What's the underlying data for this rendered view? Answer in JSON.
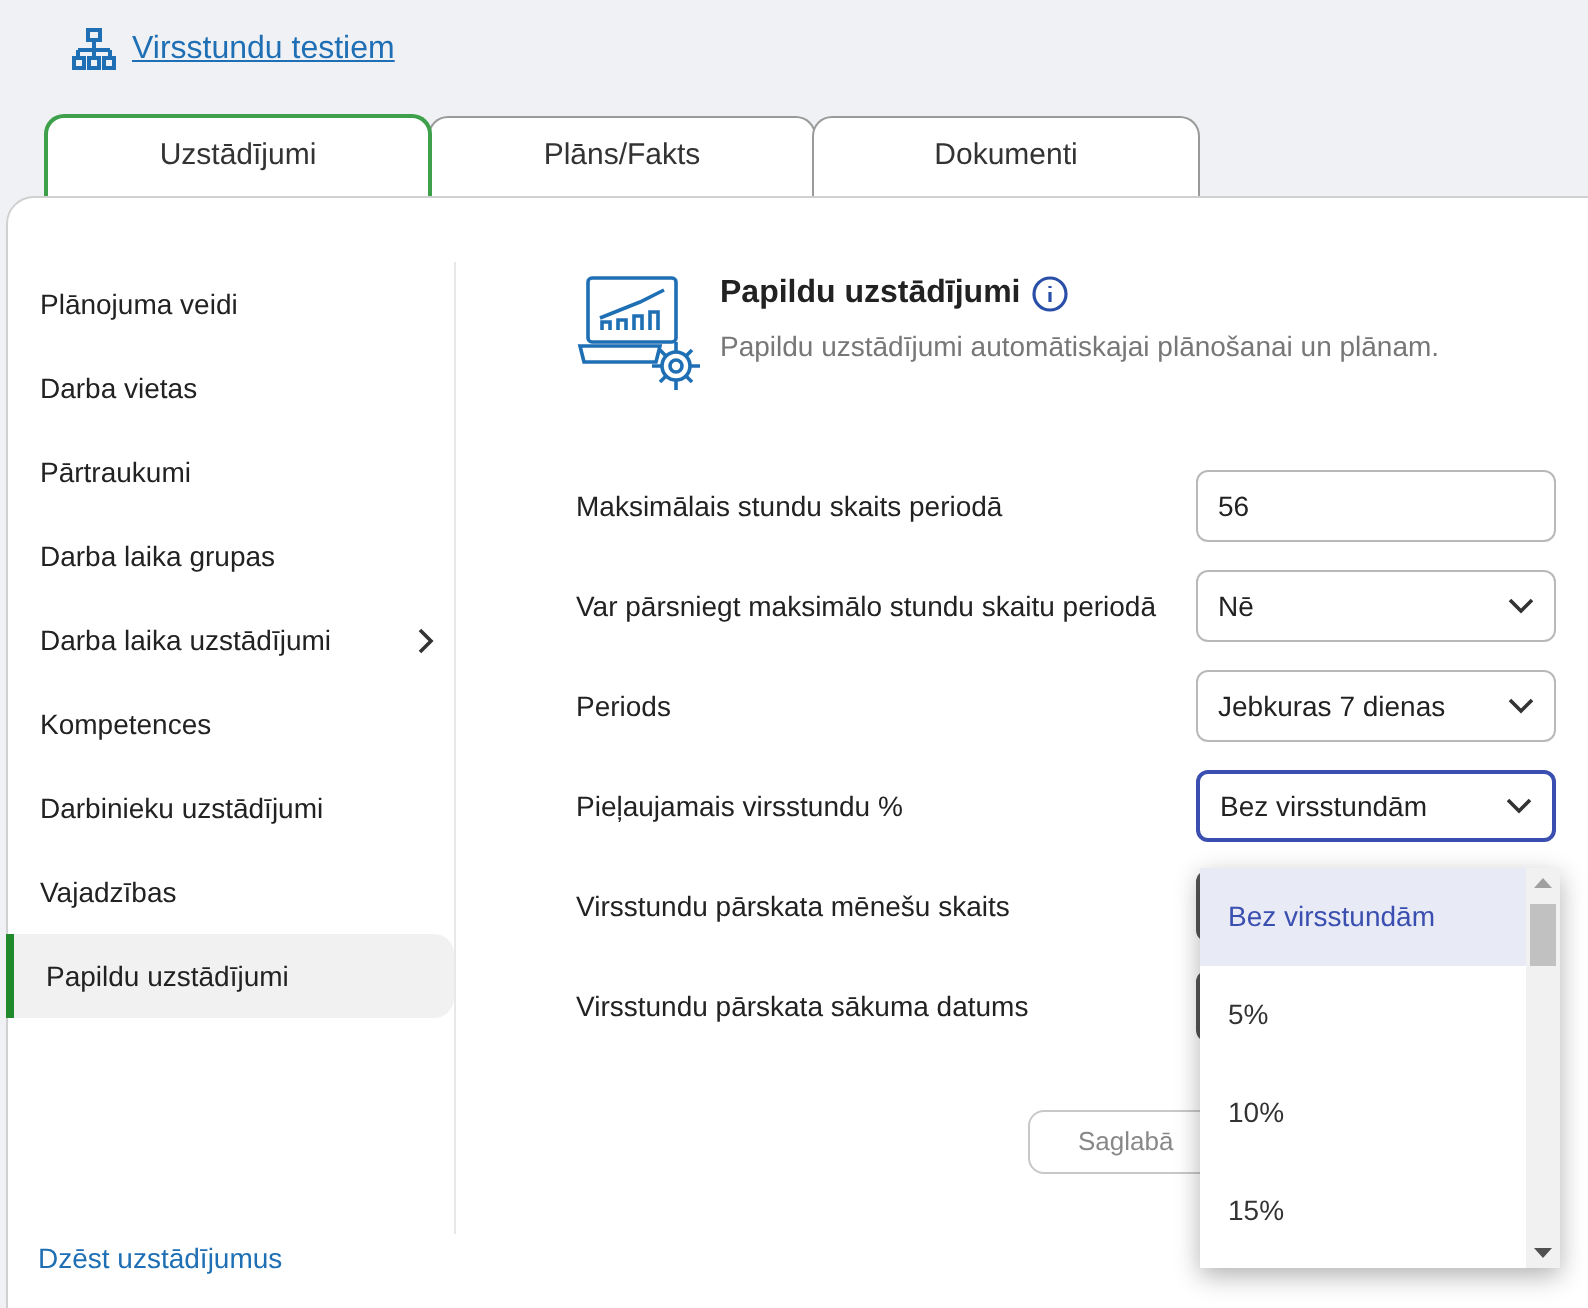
{
  "breadcrumb": {
    "label": "Virsstundu testiem"
  },
  "tabs": [
    {
      "label": "Uzstādījumi",
      "selected": true
    },
    {
      "label": "Plāns/Fakts",
      "selected": false
    },
    {
      "label": "Dokumenti",
      "selected": false
    }
  ],
  "sidebar": {
    "items": [
      {
        "label": "Plānojuma veidi",
        "selected": false,
        "expandable": false
      },
      {
        "label": "Darba vietas",
        "selected": false,
        "expandable": false
      },
      {
        "label": "Pārtraukumi",
        "selected": false,
        "expandable": false
      },
      {
        "label": "Darba laika grupas",
        "selected": false,
        "expandable": false
      },
      {
        "label": "Darba laika uzstādījumi",
        "selected": false,
        "expandable": true
      },
      {
        "label": "Kompetences",
        "selected": false,
        "expandable": false
      },
      {
        "label": "Darbinieku uzstādījumi",
        "selected": false,
        "expandable": false
      },
      {
        "label": "Vajadzības",
        "selected": false,
        "expandable": false
      },
      {
        "label": "Papildu uzstādījumi",
        "selected": true,
        "expandable": false
      }
    ],
    "footer_link": "Dzēst uzstādījumus"
  },
  "section": {
    "title": "Papildu uzstādījumi",
    "description": "Papildu uzstādījumi automātiskajai plānošanai un plānam."
  },
  "form": {
    "rows": [
      {
        "label": "Maksimālais stundu skaits periodā",
        "kind": "input",
        "value": "56",
        "focused": false
      },
      {
        "label": "Var pārsniegt maksimālo stundu skaitu periodā",
        "kind": "select",
        "value": "Nē",
        "focused": false
      },
      {
        "label": "Periods",
        "kind": "select",
        "value": "Jebkuras 7 dienas",
        "focused": false
      },
      {
        "label": "Pieļaujamais virsstundu %",
        "kind": "select",
        "value": "Bez virsstundām",
        "focused": true
      },
      {
        "label": "Virsstundu pārskata mēnešu skaits",
        "kind": "covered"
      },
      {
        "label": "Virsstundu pārskata sākuma datums",
        "kind": "covered"
      }
    ],
    "save_button": "Saglabā"
  },
  "dropdown": {
    "options": [
      {
        "label": "Bez virsstundām",
        "selected": true
      },
      {
        "label": "5%",
        "selected": false
      },
      {
        "label": "10%",
        "selected": false
      },
      {
        "label": "15%",
        "selected": false
      }
    ]
  }
}
